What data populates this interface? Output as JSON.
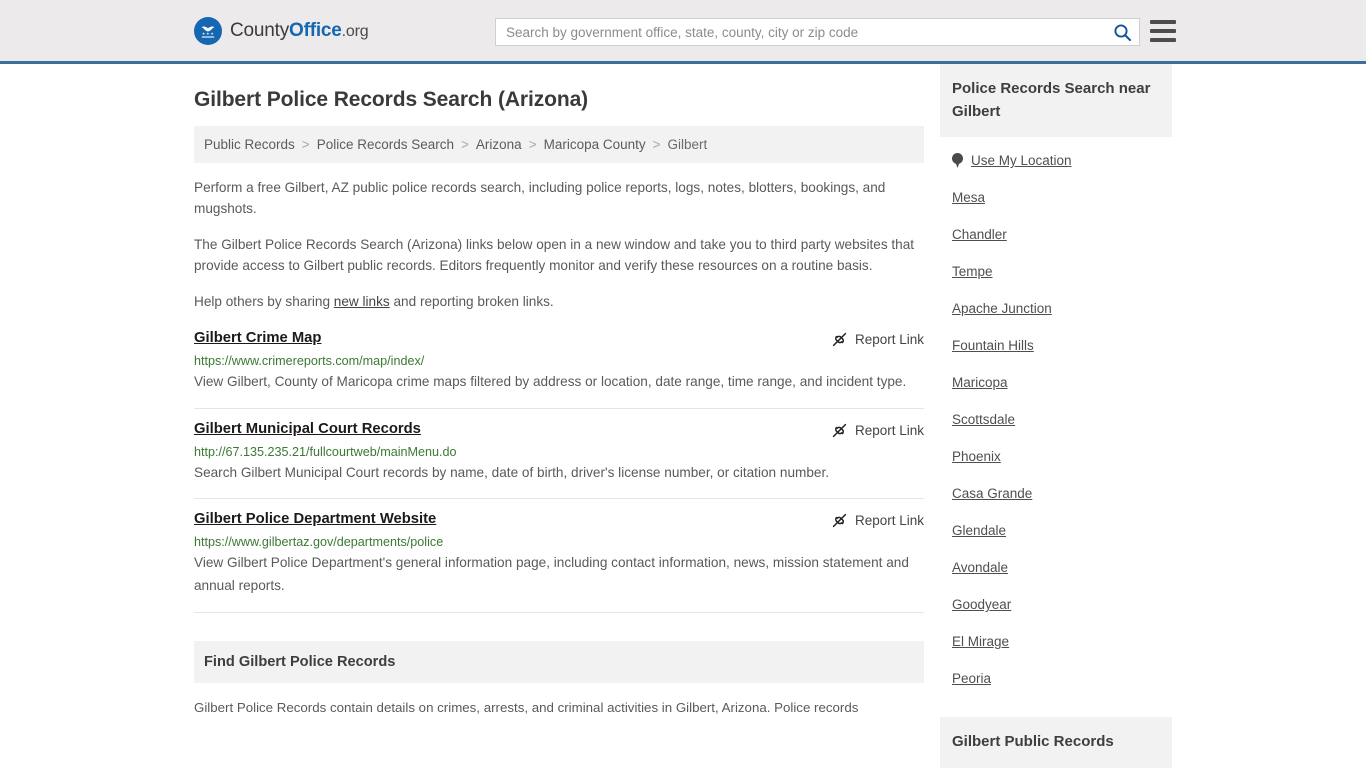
{
  "header": {
    "brand": {
      "plain1": "County",
      "strong": "Office",
      "tld": ".org",
      "icon": "eagle-seal-icon"
    },
    "search": {
      "placeholder": "Search by government office, state, county, city or zip code",
      "value": "",
      "icon": "search-icon"
    },
    "menu_icon": "hamburger-menu-icon",
    "accent_color": "#3d6f9e",
    "background_color": "#eceaea"
  },
  "page": {
    "title": "Gilbert Police Records Search (Arizona)"
  },
  "breadcrumb": {
    "items": [
      {
        "label": "Public Records",
        "current": false
      },
      {
        "label": "Police Records Search",
        "current": false
      },
      {
        "label": "Arizona",
        "current": false
      },
      {
        "label": "Maricopa County",
        "current": false
      },
      {
        "label": "Gilbert",
        "current": true
      }
    ],
    "separator": ">"
  },
  "intro": {
    "paragraph1": "Perform a free Gilbert, AZ public police records search, including police reports, logs, notes, blotters, bookings, and mugshots.",
    "paragraph2": "The Gilbert Police Records Search (Arizona) links below open in a new window and take you to third party websites that provide access to Gilbert public records. Editors frequently monitor and verify these resources on a routine basis.",
    "paragraph3_before": "Help others by sharing ",
    "paragraph3_link": "new links",
    "paragraph3_after": " and reporting broken links."
  },
  "results": {
    "report_label": "Report Link",
    "report_icon": "broken-link-icon",
    "items": [
      {
        "title": "Gilbert Crime Map",
        "url": "https://www.crimereports.com/map/index/",
        "description": "View Gilbert, County of Maricopa crime maps filtered by address or location, date range, time range, and incident type."
      },
      {
        "title": "Gilbert Municipal Court Records",
        "url": "http://67.135.235.21/fullcourtweb/mainMenu.do",
        "description": "Search Gilbert Municipal Court records by name, date of birth, driver's license number, or citation number."
      },
      {
        "title": "Gilbert Police Department Website",
        "url": "https://www.gilbertaz.gov/departments/police",
        "description": "View Gilbert Police Department's general information page, including contact information, news, mission statement and annual reports."
      }
    ]
  },
  "find_section": {
    "heading": "Find Gilbert Police Records",
    "paragraph": "Gilbert Police Records contain details on crimes, arrests, and criminal activities in Gilbert, Arizona. Police records"
  },
  "sidebar": {
    "heading": "Police Records Search near Gilbert",
    "use_my_location": {
      "label": "Use My Location",
      "icon": "map-pin-icon"
    },
    "cities": [
      "Mesa",
      "Chandler",
      "Tempe",
      "Apache Junction",
      "Fountain Hills",
      "Maricopa",
      "Scottsdale",
      "Phoenix",
      "Casa Grande",
      "Glendale",
      "Avondale",
      "Goodyear",
      "El Mirage",
      "Peoria"
    ],
    "second_card_heading": "Gilbert Public Records"
  },
  "colors": {
    "url_green": "#3b7a34",
    "body_text": "#5a5a5a",
    "panel_gray": "#f2f2f2"
  }
}
